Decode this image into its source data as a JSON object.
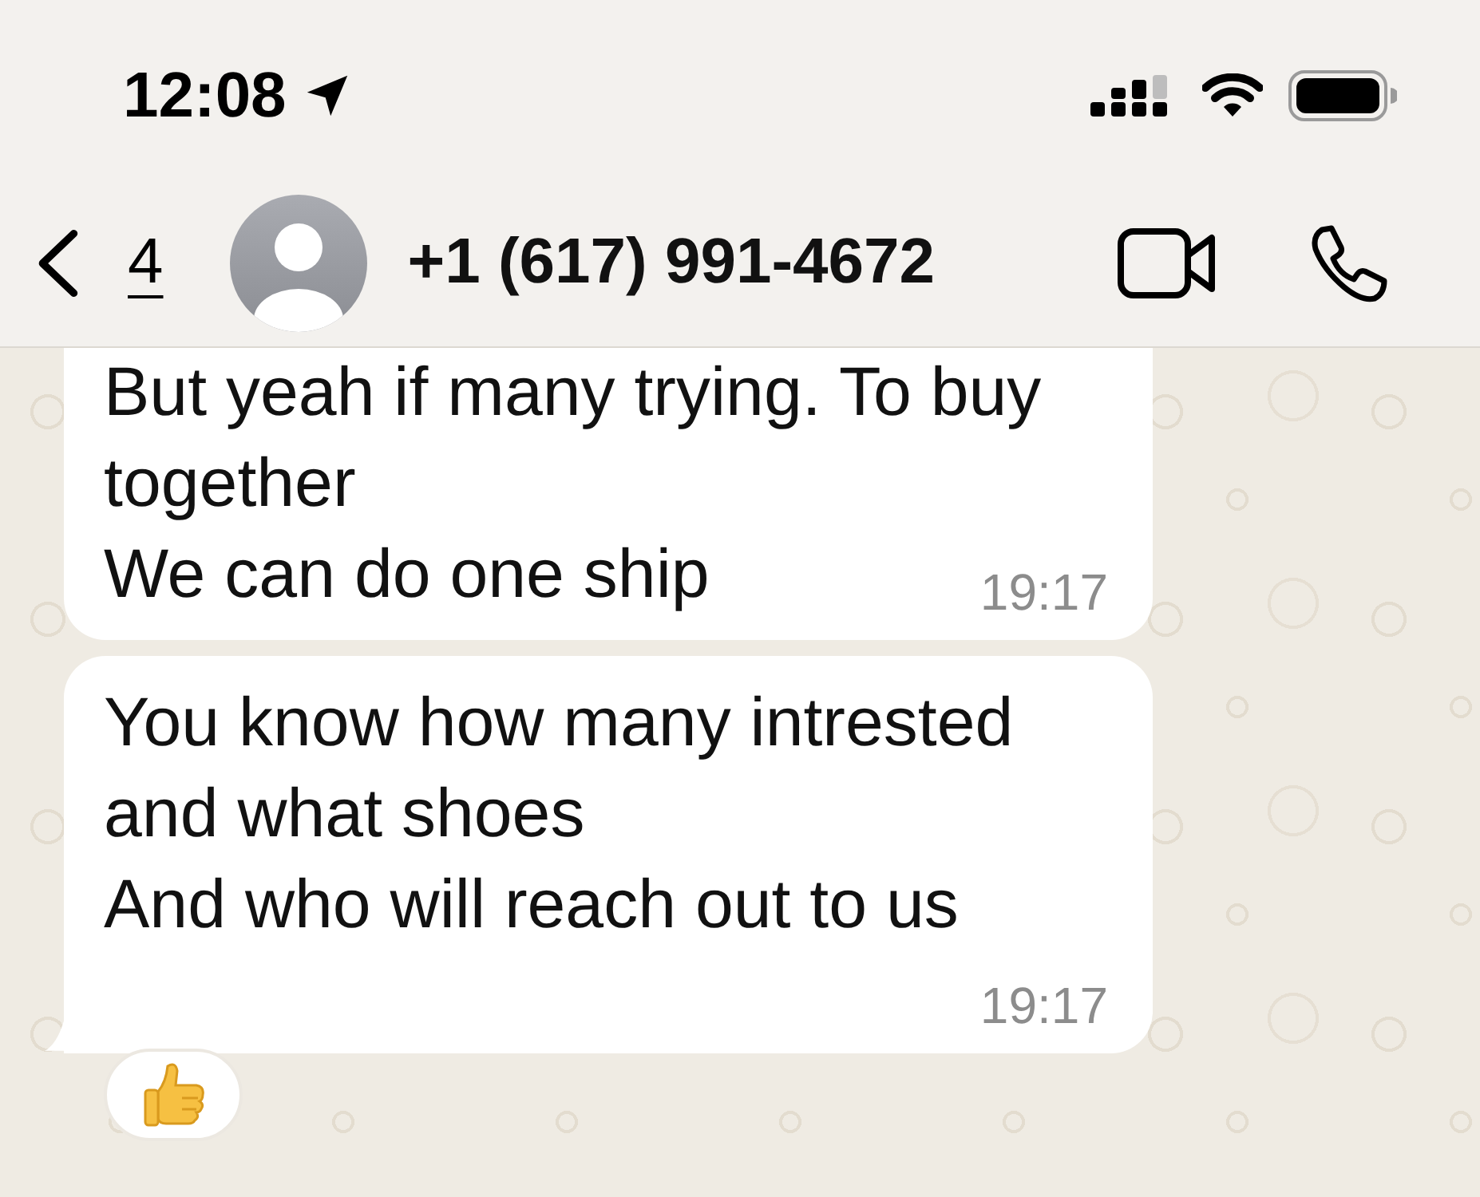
{
  "status_bar": {
    "time": "12:08"
  },
  "header": {
    "back_count": "4",
    "contact": "+1 (617) 991-4672"
  },
  "messages": [
    {
      "lines": [
        "But yeah if many trying. To buy together",
        "We can do one ship"
      ],
      "time": "19:17",
      "cut_off_top": true,
      "tail": false,
      "reaction": false
    },
    {
      "lines": [
        "You know how many intrested and what shoes",
        "And who will reach out to us"
      ],
      "time": "19:17",
      "cut_off_top": false,
      "tail": true,
      "reaction": true
    }
  ]
}
